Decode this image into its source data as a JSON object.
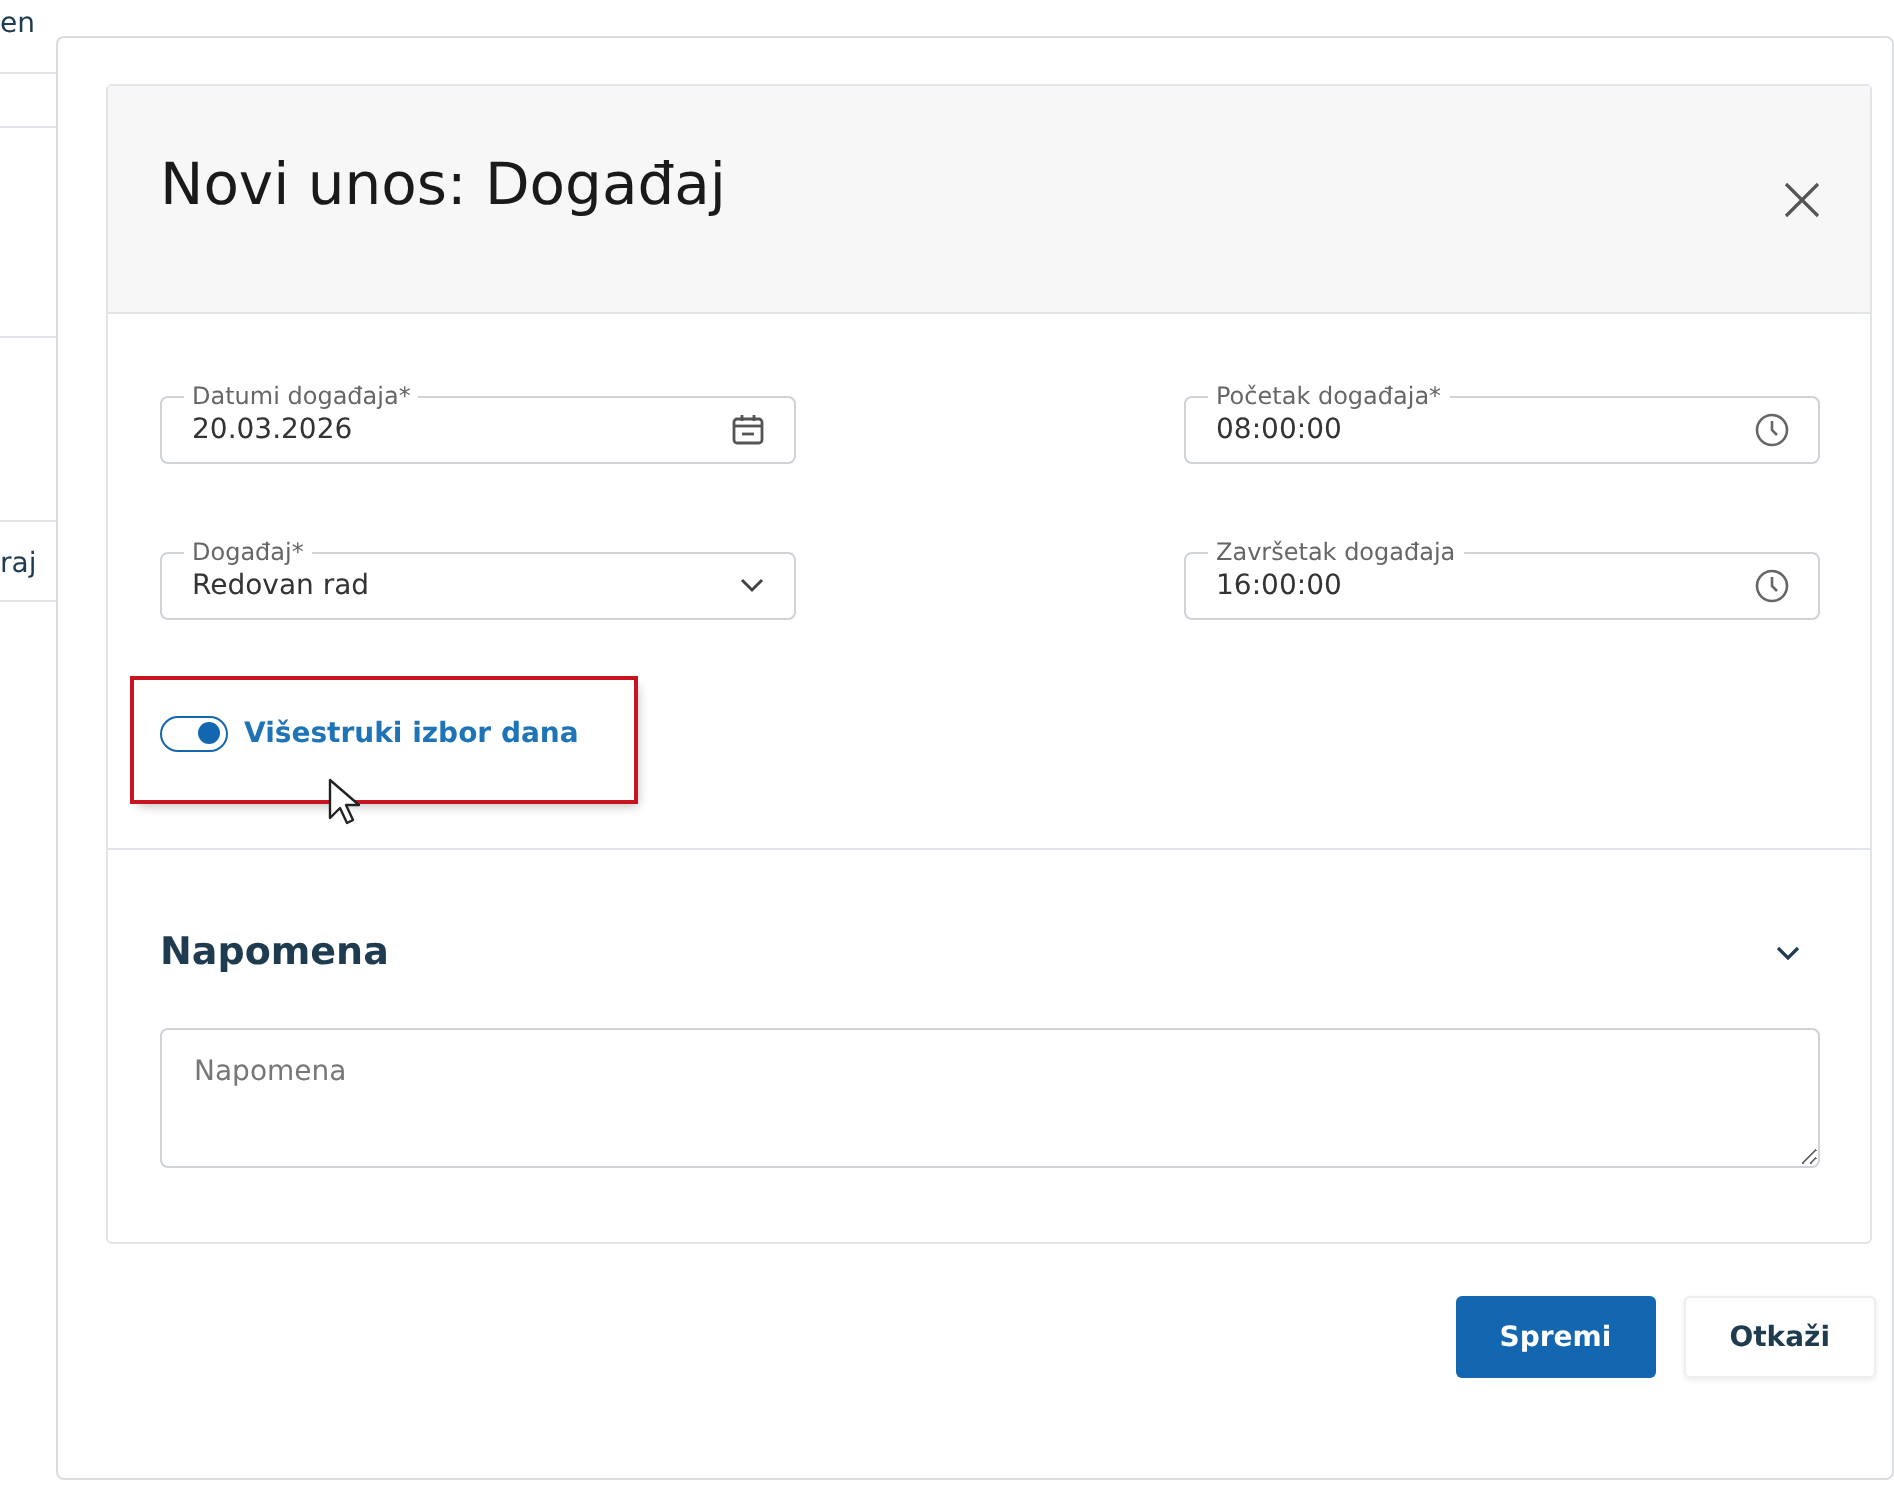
{
  "background": {
    "fragments": [
      "en",
      "raj"
    ]
  },
  "dialog": {
    "title": "Novi unos: Događaj",
    "fields": [
      {
        "label": "Datumi događaja*",
        "value": "20.03.2026",
        "kind": "date"
      },
      {
        "label": "Početak događaja*",
        "value": "08:00:00",
        "kind": "time"
      },
      {
        "label": "Događaj*",
        "value": "Redovan rad",
        "kind": "select"
      },
      {
        "label": "Završetak događaja",
        "value": "16:00:00",
        "kind": "time"
      }
    ],
    "toggle": {
      "label": "Višestruki izbor dana",
      "on": true,
      "highlighted": true
    },
    "note_section": {
      "title": "Napomena",
      "expanded": true,
      "placeholder": "Napomena"
    },
    "buttons": [
      {
        "label": "Spremi",
        "kind": "primary"
      },
      {
        "label": "Otkaži",
        "kind": "secondary"
      }
    ]
  }
}
